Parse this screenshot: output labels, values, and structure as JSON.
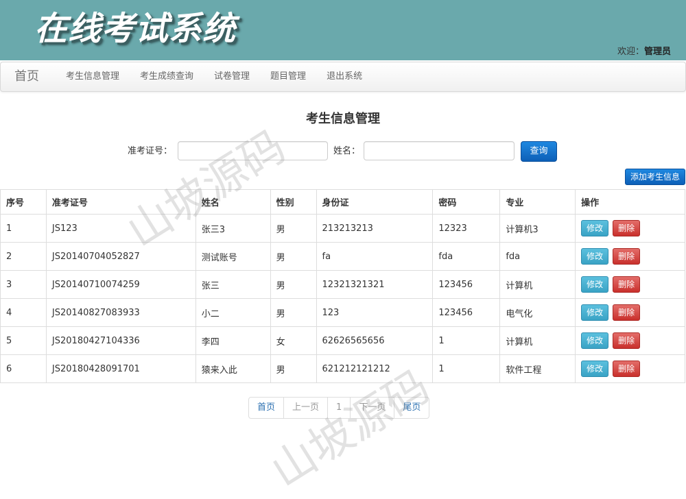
{
  "header": {
    "title": "在线考试系统",
    "welcome_prefix": "欢迎：",
    "user": "管理员"
  },
  "nav": {
    "brand": "首页",
    "items": [
      "考生信息管理",
      "考生成绩查询",
      "试卷管理",
      "题目管理",
      "退出系统"
    ]
  },
  "page": {
    "title": "考生信息管理",
    "search": {
      "ticket_label": "准考证号：",
      "ticket_value": "",
      "name_label": "姓名：",
      "name_value": "",
      "query_button": "查询"
    },
    "add_button": "添加考生信息"
  },
  "table": {
    "headers": [
      "序号",
      "准考证号",
      "姓名",
      "性别",
      "身份证",
      "密码",
      "专业",
      "操作"
    ],
    "rows": [
      [
        "1",
        "JS123",
        "张三3",
        "男",
        "213213213",
        "12323",
        "计算机3"
      ],
      [
        "2",
        "JS20140704052827",
        "测试账号",
        "男",
        "fa",
        "fda",
        "fda"
      ],
      [
        "3",
        "JS20140710074259",
        "张三",
        "男",
        "12321321321",
        "123456",
        "计算机"
      ],
      [
        "4",
        "JS20140827083933",
        "小二",
        "男",
        "123",
        "123456",
        "电气化"
      ],
      [
        "5",
        "JS20180427104336",
        "李四",
        "女",
        "62626565656",
        "1",
        "计算机"
      ],
      [
        "6",
        "JS20180428091701",
        "猿来入此",
        "男",
        "621212121212",
        "1",
        "软件工程"
      ]
    ],
    "edit_label": "修改",
    "delete_label": "删除"
  },
  "pagination": {
    "first": "首页",
    "prev": "上一页",
    "current": "1",
    "next": "下一页",
    "last": "尾页"
  },
  "watermark": "山坡源码",
  "colors": {
    "banner": "#6aa9ac",
    "primary": "#0d5fb7",
    "info": "#5bc0de",
    "danger": "#c9302c"
  }
}
